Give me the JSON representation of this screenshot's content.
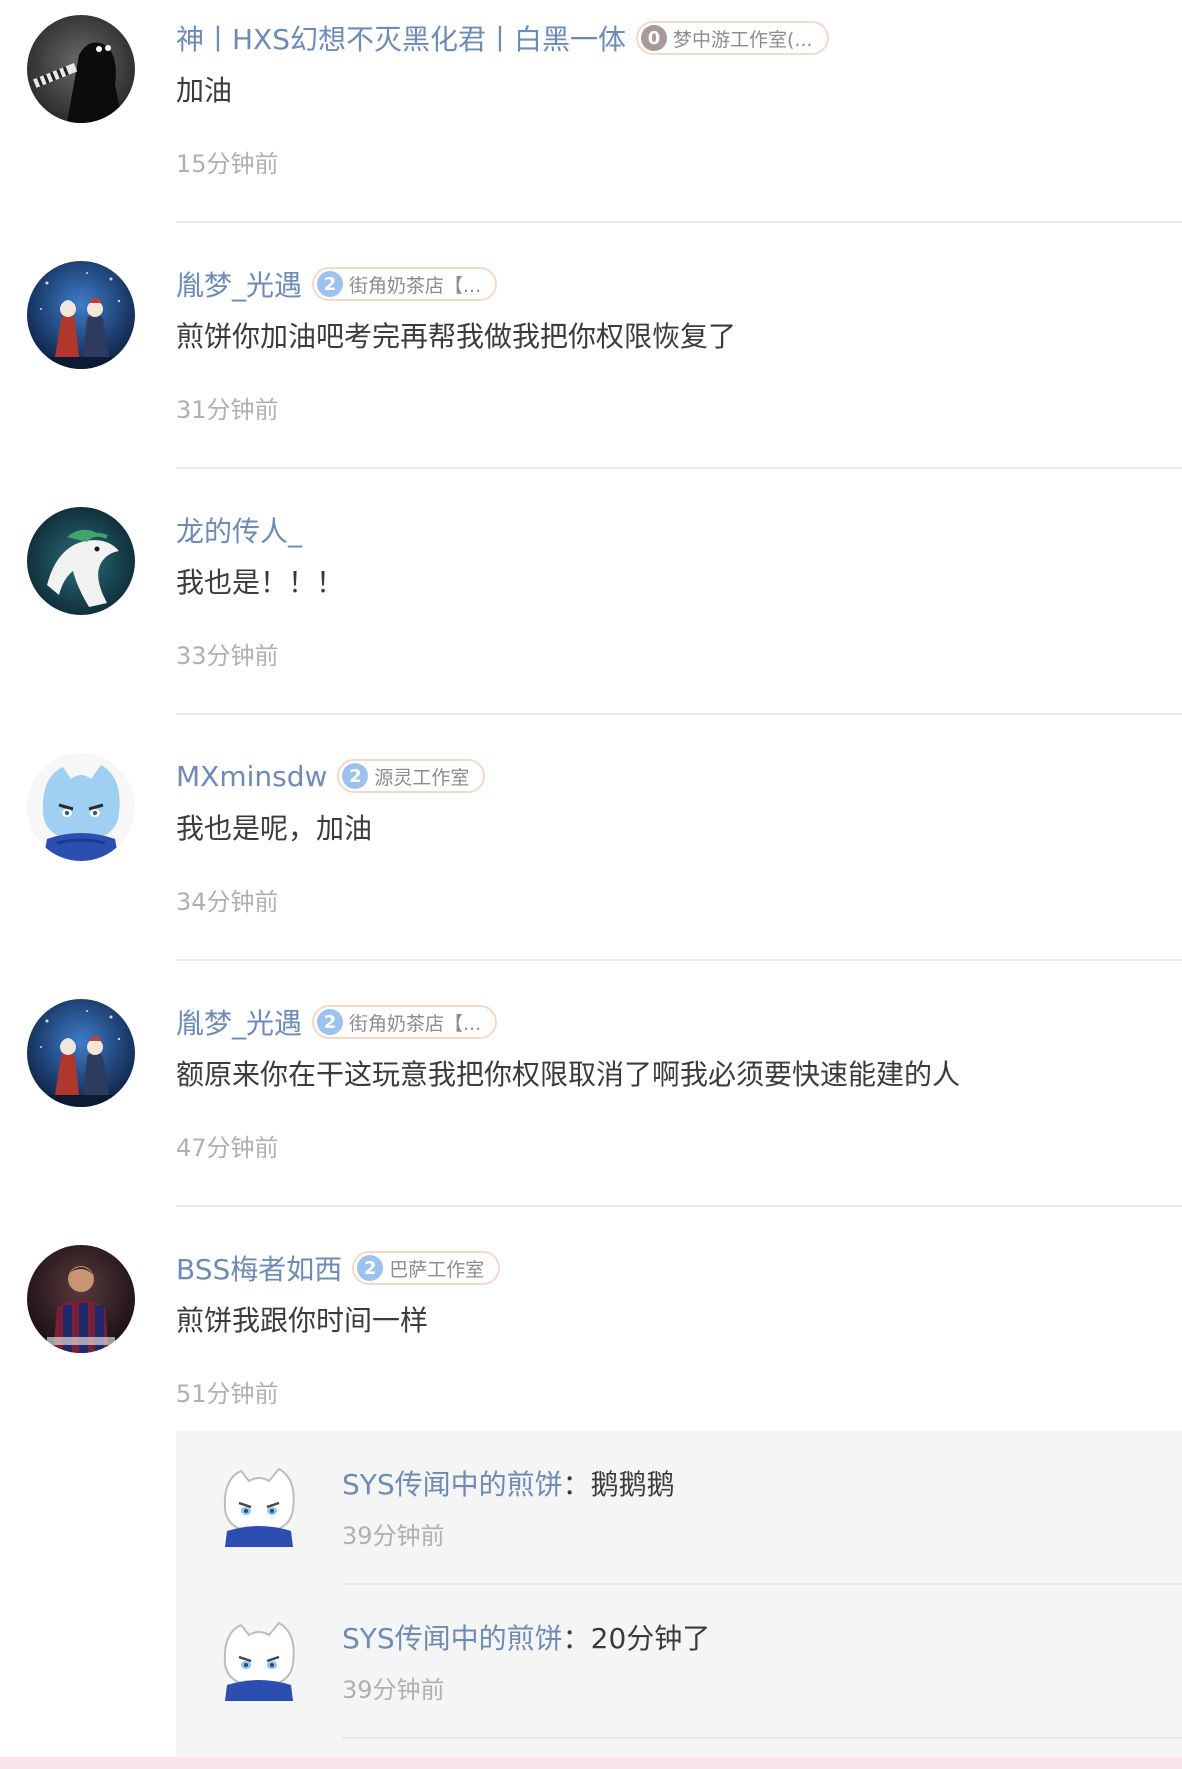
{
  "comments": [
    {
      "username": "神丨HXS幻想不灭黑化君丨白黑一体",
      "level": "0",
      "studio": "梦中游工作室(...",
      "text": "加油",
      "time": "15分钟前",
      "avatar_icon": "shadow-creature-avatar",
      "badge_color": "#a89a9a"
    },
    {
      "username": "胤梦_光遇",
      "level": "2",
      "studio": "街角奶茶店【...",
      "text": "煎饼你加油吧考完再帮我做我把你权限恢复了",
      "time": "31分钟前",
      "avatar_icon": "sky-children-avatar",
      "badge_color": "#9cc2ee"
    },
    {
      "username": "龙的传人_",
      "level": null,
      "studio": null,
      "text": "我也是！！！",
      "time": "33分钟前",
      "avatar_icon": "white-dragon-avatar",
      "badge_color": null
    },
    {
      "username": "MXminsdw",
      "level": "2",
      "studio": "源灵工作室",
      "text": "我也是呢，加油",
      "time": "34分钟前",
      "avatar_icon": "blue-character-avatar",
      "badge_color": "#9cc2ee"
    },
    {
      "username": "胤梦_光遇",
      "level": "2",
      "studio": "街角奶茶店【...",
      "text": "额原来你在干这玩意我把你权限取消了啊我必须要快速能建的人",
      "time": "47分钟前",
      "avatar_icon": "sky-children-avatar",
      "badge_color": "#9cc2ee"
    },
    {
      "username": "BSS梅者如西",
      "level": "2",
      "studio": "巴萨工作室",
      "text": "煎饼我跟你时间一样",
      "time": "51分钟前",
      "avatar_icon": "soccer-player-avatar",
      "badge_color": "#9cc2ee"
    }
  ],
  "replies": [
    {
      "username": "SYS传闻中的煎饼",
      "colon": "：",
      "text": "鹅鹅鹅",
      "time": "39分钟前",
      "avatar_icon": "white-character-avatar"
    },
    {
      "username": "SYS传闻中的煎饼",
      "colon": "：",
      "text": "20分钟了",
      "time": "39分钟前",
      "avatar_icon": "white-character-avatar"
    }
  ],
  "colors": {
    "username": "#6e8bb6",
    "text": "#3b3b3b",
    "time": "#b0b0b0",
    "reply_background": "#f5f5f5",
    "bottom_bar": "#fbe3ec"
  }
}
